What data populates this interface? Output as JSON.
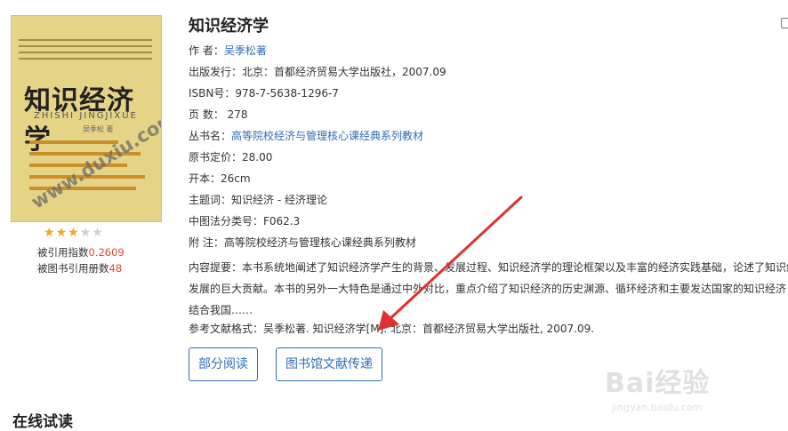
{
  "book": {
    "title": "知识经济学",
    "cover": {
      "title": "知识经济学",
      "subtitle": "ZHISHI JINGJIXUE",
      "author": "吴季松 著",
      "watermark": "www.duxiu.com"
    },
    "rating": {
      "stars_filled": 3,
      "stars_total": 5
    },
    "citation_index_label": "被引用指数",
    "citation_index_value": "0.2609",
    "cited_by_books_label": "被图书引用册数",
    "cited_by_books_value": "48"
  },
  "fields": {
    "author_label": "作 者：",
    "author_value": "吴季松著",
    "publish": "出版发行：北京：首都经济贸易大学出版社，2007.09",
    "isbn": "ISBN号：978-7-5638-1296-7",
    "pages_label": "页 数：",
    "pages_value": "278",
    "series_label": "丛书名：",
    "series_value": "高等院校经济与管理核心课经典系列教材",
    "price": "原书定价：28.00",
    "format": "开本：26cm",
    "subject": "主题词：知识经济 - 经济理论",
    "classification": "中图法分类号：F062.3",
    "note": "附 注：高等院校经济与管理核心课经典系列教材",
    "summary_lines": [
      "内容提要：本书系统地阐述了知识经济学产生的背景、发展过程、知识经济学的理论框架以及丰富的经济实践基础，论述了知识经",
      "发展的巨大贡献。本书的另外一大特色是通过中外对比，重点介绍了知识经济的历史渊源、循环经济和主要发达国家的知识经济",
      "结合我国……"
    ],
    "reference": "参考文献格式：吴季松著. 知识经济学[M]. 北京：首都经济贸易大学出版社, 2007.09."
  },
  "buttons": {
    "partial_read": "部分阅读",
    "library_delivery": "图书馆文献传递"
  },
  "section": {
    "online_trial": "在线试读"
  },
  "watermark": {
    "logo": "Bai经验",
    "url": "jingyan.baidu.com"
  },
  "colors": {
    "link": "#2f6db5",
    "highlight_number": "#e43",
    "arrow": "#e03131",
    "star": "#f5a623"
  }
}
